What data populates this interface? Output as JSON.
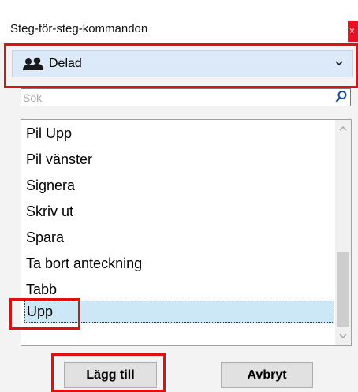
{
  "window": {
    "title": "Steg-för-steg-kommandon",
    "close_glyph": "×"
  },
  "dropdown": {
    "icon": "group-users-icon",
    "selected": "Delad",
    "chevron": "⌄"
  },
  "search": {
    "placeholder": "Sök",
    "value": "",
    "icon": "search-icon"
  },
  "list": {
    "items": [
      {
        "label": "Pil Upp",
        "selected": false
      },
      {
        "label": "Pil vänster",
        "selected": false
      },
      {
        "label": "Signera",
        "selected": false
      },
      {
        "label": "Skriv ut",
        "selected": false
      },
      {
        "label": "Spara",
        "selected": false
      },
      {
        "label": "Ta bort anteckning",
        "selected": false
      },
      {
        "label": "Tabb",
        "selected": false
      },
      {
        "label": "Upp",
        "selected": true
      }
    ],
    "scroll_up_glyph": "^",
    "scroll_down_glyph": "v"
  },
  "buttons": {
    "add_label": "Lägg till",
    "cancel_label": "Avbryt"
  },
  "colors": {
    "highlight": "#e01010",
    "selection": "#cce8f7",
    "dropdown_bg": "#dbe9f9",
    "close": "#e81123"
  }
}
